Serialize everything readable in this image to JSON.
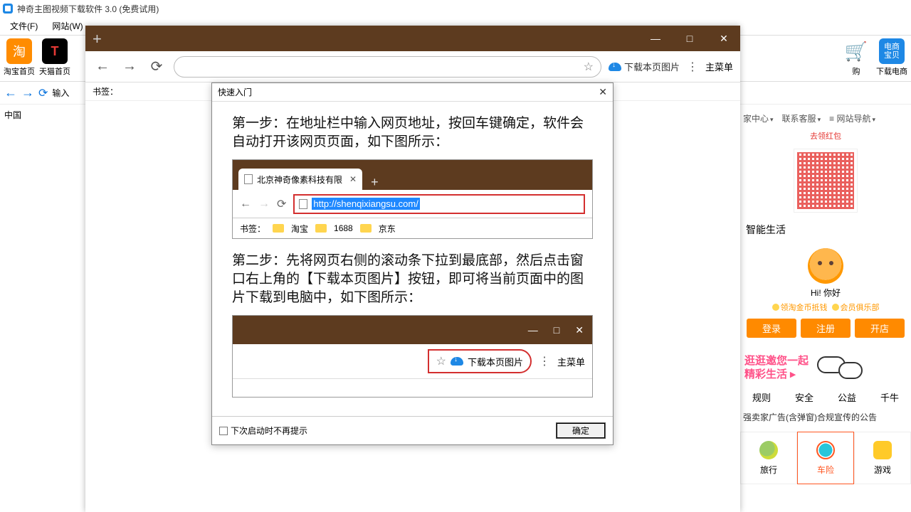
{
  "app": {
    "title": "神奇主图视频下载软件 3.0 (免费试用)"
  },
  "menubar": {
    "file": "文件(F)",
    "site": "网站(W)"
  },
  "toolbar": {
    "taobao": "淘宝首页",
    "tmall": "天猫首页",
    "cart": "购",
    "dianshang": "电商宝贝",
    "dl_ds": "下载电商"
  },
  "subbar": {
    "input_label": "输入"
  },
  "region": "中国",
  "right": {
    "center": "家中心",
    "kefu": "联系客服",
    "nav": "网站导航",
    "qr_title": "去领红包",
    "smart": "智能生活",
    "hi": "Hi! 你好",
    "pill1": "领淘金币抵钱",
    "pill2": "会员俱乐部",
    "login": "登录",
    "reg": "注册",
    "open": "开店",
    "promo_l1": "逛逛邀您一起",
    "promo_l2": "精彩生活",
    "tab1": "规则",
    "tab2": "安全",
    "tab3": "公益",
    "tab4": "千牛",
    "notice": "强卖家广告(含弹窗)合规宣传的公告",
    "g1": "旅行",
    "g2": "车险",
    "g3": "游戏"
  },
  "browser": {
    "download_label": "下载本页图片",
    "main_menu": "主菜单",
    "bookmarks": "书签："
  },
  "dialog": {
    "title": "快速入门",
    "step1": "第一步：在地址栏中输入网页地址，按回车键确定，软件会自动打开该网页页面，如下图所示：",
    "tab_title": "北京神奇像素科技有限",
    "url": "http://shenqixiangsu.com/",
    "bm": "书签：",
    "bm1": "淘宝",
    "bm2": "1688",
    "bm3": "京东",
    "step2": "第二步：先将网页右侧的滚动条下拉到最底部，然后点击窗口右上角的【下载本页图片】按钮，即可将当前页面中的图片下载到电脑中，如下图所示：",
    "dl2": "下载本页图片",
    "menu2": "主菜单",
    "dont_show": "下次启动时不再提示",
    "ok": "确定"
  }
}
